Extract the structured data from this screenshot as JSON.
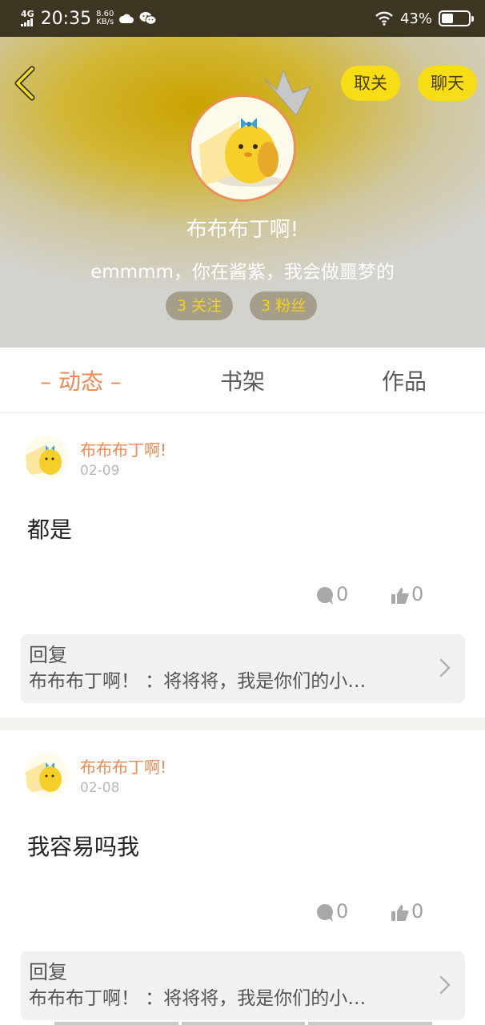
{
  "status_bar": {
    "network": "4G",
    "time": "20:35",
    "speed_value": "8.60",
    "speed_unit": "KB/s",
    "battery": "43%",
    "battery_level": 0.43
  },
  "header": {
    "unfollow_label": "取关",
    "chat_label": "聊天",
    "name": "布布布丁啊!",
    "bio": "emmmm，你在酱紫，我会做噩梦的",
    "following": "3 关注",
    "fans": "3 粉丝"
  },
  "tabs": [
    "– 动态 –",
    "书架",
    "作品"
  ],
  "posts": [
    {
      "author": "布布布丁啊!",
      "date": "02-09",
      "text": "都是",
      "comments": "0",
      "likes": "0",
      "reply_title": "回复",
      "reply_preview": "布布布丁啊！ ：将将将，我是你们的小…"
    },
    {
      "author": "布布布丁啊!",
      "date": "02-08",
      "text": "我容易吗我",
      "comments": "0",
      "likes": "0",
      "reply_title": "回复",
      "reply_preview": "布布布丁啊！ ：将将将，我是你们的小…"
    }
  ],
  "colors": {
    "accent": "#ef8a52",
    "button_yellow": "#f6dd15",
    "status_bar": "#3b3522"
  }
}
